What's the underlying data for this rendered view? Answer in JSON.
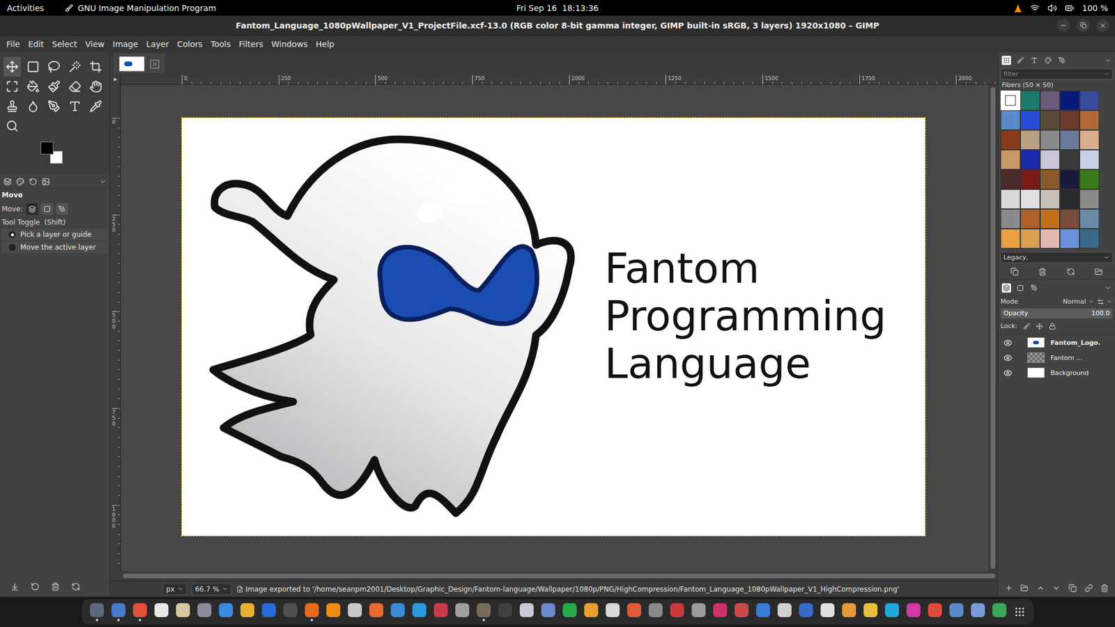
{
  "topbar": {
    "activities": "Activities",
    "app": "GNU Image Manipulation Program",
    "clock": "Fri Sep 16  18:13:36",
    "battery": "100 %"
  },
  "window": {
    "title": "Fantom_Language_1080pWallpaper_V1_ProjectFile.xcf-13.0 (RGB color 8-bit gamma integer, GIMP built-in sRGB, 3 layers) 1920x1080 – GIMP"
  },
  "menu": [
    "File",
    "Edit",
    "Select",
    "View",
    "Image",
    "Layer",
    "Colors",
    "Tools",
    "Filters",
    "Windows",
    "Help"
  ],
  "colors": {
    "foreground": "#000000",
    "background": "#ffffff"
  },
  "tool_options": {
    "title": "Move",
    "move_label": "Move:",
    "toggle_label": "Tool Toggle  (Shift)",
    "options": [
      {
        "label": "Pick a layer or guide",
        "selected": true
      },
      {
        "label": "Move the active layer",
        "selected": false
      }
    ]
  },
  "rulers": {
    "horizontal": [
      "0",
      "250",
      "500",
      "750",
      "1000",
      "1250",
      "1500",
      "1750",
      "2000"
    ],
    "vertical": [
      "0",
      "250",
      "500",
      "750",
      "1000"
    ]
  },
  "canvas": {
    "lines": [
      "Fantom",
      "Programming",
      "Language"
    ]
  },
  "patterns": {
    "filter_placeholder": "filter",
    "current": "Fibers (50 × 50)",
    "tag": "Legacy,",
    "items": [
      {
        "color": "#ffffff",
        "selected": true
      },
      {
        "color": "#1e7a6a",
        "selected": false
      },
      {
        "color": "#6a5a7a",
        "selected": false
      },
      {
        "color": "#0a1a7a",
        "selected": false
      },
      {
        "color": "#3a4a9a",
        "selected": false
      },
      {
        "color": "#5a8ac8",
        "selected": false
      },
      {
        "color": "#2a4ad8",
        "selected": false
      },
      {
        "color": "#5a4a3a",
        "selected": false
      },
      {
        "color": "#6a3a2a",
        "selected": false
      },
      {
        "color": "#b06a3a",
        "selected": false
      },
      {
        "color": "#8a3a1a",
        "selected": false
      },
      {
        "color": "#b8a080",
        "selected": false
      },
      {
        "color": "#8a8a8a",
        "selected": false
      },
      {
        "color": "#6a7a9a",
        "selected": false
      },
      {
        "color": "#d8b090",
        "selected": false
      },
      {
        "color": "#c89a6a",
        "selected": false
      },
      {
        "color": "#1a2aa8",
        "selected": false
      },
      {
        "color": "#c8c8d8",
        "selected": false
      },
      {
        "color": "#3a3a3a",
        "selected": false
      },
      {
        "color": "#c8d0e8",
        "selected": false
      },
      {
        "color": "#4a2a2a",
        "selected": false
      },
      {
        "color": "#7a1a1a",
        "selected": false
      },
      {
        "color": "#8a5a2a",
        "selected": false
      },
      {
        "color": "#1a1a3a",
        "selected": false
      },
      {
        "color": "#3a7a1a",
        "selected": false
      },
      {
        "color": "#d8d8d8",
        "selected": false
      },
      {
        "color": "#e0e0e0",
        "selected": false
      },
      {
        "color": "#c8c0b8",
        "selected": false
      },
      {
        "color": "#2a2a2a",
        "selected": false
      },
      {
        "color": "#8a8a8a",
        "selected": false
      },
      {
        "color": "#8a8a8a",
        "selected": false
      },
      {
        "color": "#b0602a",
        "selected": false
      },
      {
        "color": "#c0701a",
        "selected": false
      },
      {
        "color": "#7a4a3a",
        "selected": false
      },
      {
        "color": "#6a8aa8",
        "selected": false
      },
      {
        "color": "#e8a040",
        "selected": false
      },
      {
        "color": "#d8a050",
        "selected": false
      },
      {
        "color": "#e0b8b0",
        "selected": false
      },
      {
        "color": "#6a90d8",
        "selected": false
      },
      {
        "color": "#3a6a8a",
        "selected": false
      }
    ]
  },
  "layers": {
    "mode_label": "Mode",
    "mode": "Normal",
    "opacity_label": "Opacity",
    "opacity": "100.0",
    "opacity_level": 1,
    "lock_label": "Lock:",
    "items": [
      {
        "name": "Fantom_Logo.",
        "kind": "logo",
        "visible": true,
        "selected": true
      },
      {
        "name": "Fantom ...",
        "kind": "text",
        "visible": true,
        "selected": false
      },
      {
        "name": "Background",
        "kind": "fill",
        "visible": true,
        "selected": false
      }
    ]
  },
  "status_bar": {
    "unit": "px",
    "zoom": "66.7 %",
    "message": "Image exported to '/home/seanpm2001/Desktop/Graphic_Design/Fantom-language/Wallpaper/1080p/PNG/HighCompression/Fantom_Language_1080pWallpaper_V1_HighCompression.png'"
  },
  "dock": {
    "items": [
      {
        "color": "#5a6a7a",
        "running": true
      },
      {
        "color": "#4a7ac8",
        "running": true
      },
      {
        "color": "#e0503a",
        "running": true
      },
      {
        "color": "#e8e8e8",
        "running": false
      },
      {
        "color": "#d8c8a0",
        "running": false
      },
      {
        "color": "#8a8a9a",
        "running": false
      },
      {
        "color": "#3a8ae0",
        "running": false
      },
      {
        "color": "#e8b030",
        "running": false
      },
      {
        "color": "#2a6ad8",
        "running": false
      },
      {
        "color": "#505050",
        "running": false
      },
      {
        "color": "#e86a20",
        "running": true
      },
      {
        "color": "#f08a10",
        "running": false
      },
      {
        "color": "#c8c8c8",
        "running": false
      },
      {
        "color": "#e86a30",
        "running": false
      },
      {
        "color": "#3a8ad8",
        "running": false
      },
      {
        "color": "#2a9ae0",
        "running": false
      },
      {
        "color": "#c83a4a",
        "running": false
      },
      {
        "color": "#a0a0a0",
        "running": false
      },
      {
        "color": "#7a6a5a",
        "running": true
      },
      {
        "color": "#404040",
        "running": false
      },
      {
        "color": "#c8c8d8",
        "running": false
      },
      {
        "color": "#6a8ac8",
        "running": false
      },
      {
        "color": "#2aa84a",
        "running": false
      },
      {
        "color": "#e8a030",
        "running": false
      },
      {
        "color": "#d8d8d8",
        "running": false
      },
      {
        "color": "#e05a3a",
        "running": false
      },
      {
        "color": "#8a8a8a",
        "running": false
      },
      {
        "color": "#c83a3a",
        "running": false
      },
      {
        "color": "#9a9a9a",
        "running": false
      },
      {
        "color": "#d0306a",
        "running": false
      },
      {
        "color": "#c84a4a",
        "running": false
      },
      {
        "color": "#3a7ad8",
        "running": false
      },
      {
        "color": "#d0d0d0",
        "running": false
      },
      {
        "color": "#3a6ac8",
        "running": false
      },
      {
        "color": "#e0e0e0",
        "running": false
      },
      {
        "color": "#e89a3a",
        "running": false
      },
      {
        "color": "#e8c040",
        "running": false
      },
      {
        "color": "#20a8d8",
        "running": false
      },
      {
        "color": "#d03aa0",
        "running": false
      },
      {
        "color": "#e04a3a",
        "running": false
      },
      {
        "color": "#5a8ac8",
        "running": false
      },
      {
        "color": "#7a9ad8",
        "running": false
      },
      {
        "color": "#3aa85a",
        "running": false
      }
    ]
  }
}
